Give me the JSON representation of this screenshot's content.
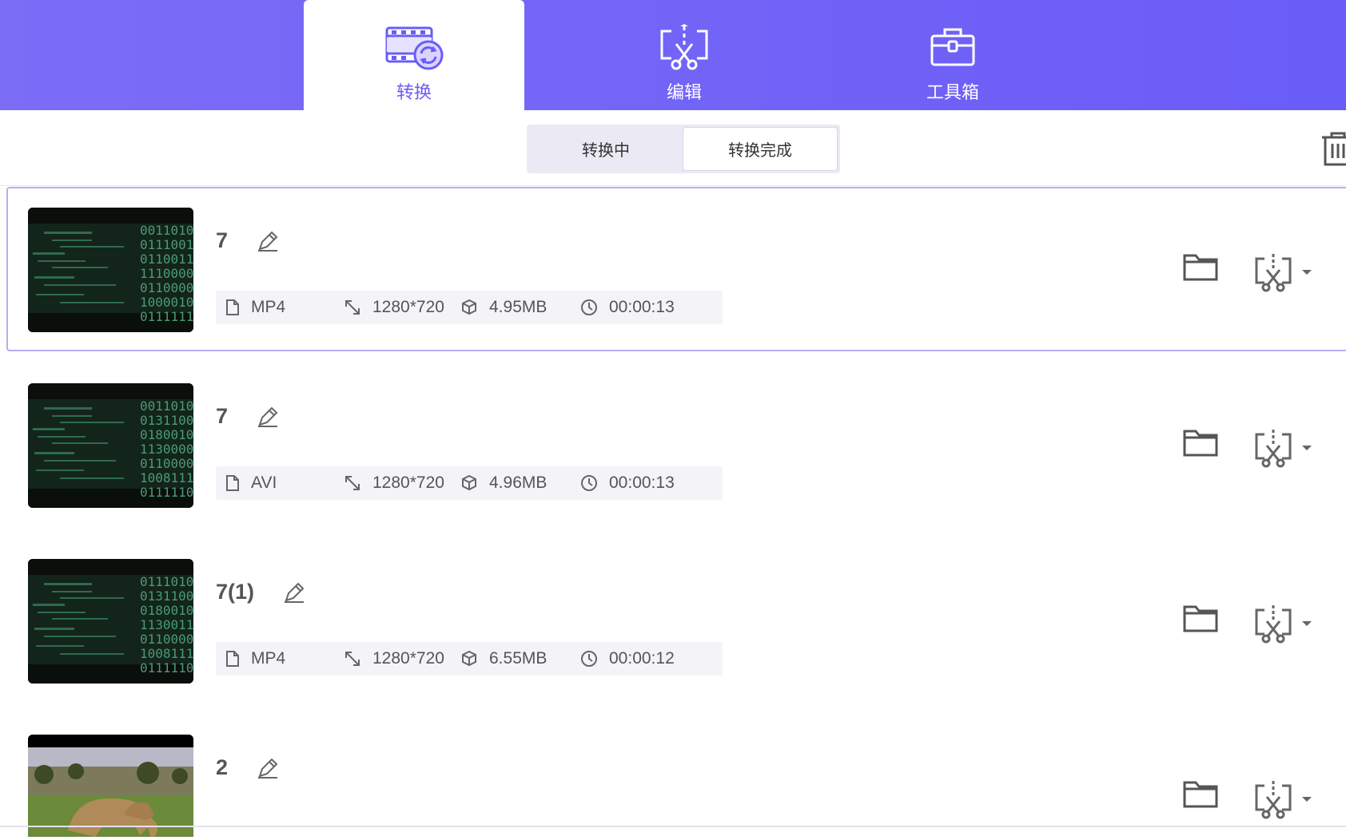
{
  "colors": {
    "accent": "#6a5cf7",
    "header_bg": "#7b6df6",
    "selected_border": "#b6acf7"
  },
  "tabs": [
    {
      "label": "转换",
      "icon": "video-convert-icon",
      "active": true
    },
    {
      "label": "编辑",
      "icon": "edit-cut-icon",
      "active": false
    },
    {
      "label": "工具箱",
      "icon": "toolbox-icon",
      "active": false
    }
  ],
  "segments": [
    {
      "label": "转换中",
      "active": false
    },
    {
      "label": "转换完成",
      "active": true
    }
  ],
  "files": [
    {
      "name": "7",
      "format": "MP4",
      "resolution": "1280*720",
      "size": "4.95MB",
      "duration": "00:00:13",
      "thumb": "code-matrix",
      "selected": true
    },
    {
      "name": "7",
      "format": "AVI",
      "resolution": "1280*720",
      "size": "4.96MB",
      "duration": "00:00:13",
      "thumb": "code-matrix",
      "selected": false
    },
    {
      "name": "7(1)",
      "format": "MP4",
      "resolution": "1280*720",
      "size": "6.55MB",
      "duration": "00:00:12",
      "thumb": "code-matrix",
      "selected": false
    },
    {
      "name": "2",
      "format": "",
      "resolution": "",
      "size": "",
      "duration": "",
      "thumb": "lion-savanna",
      "selected": false
    }
  ]
}
